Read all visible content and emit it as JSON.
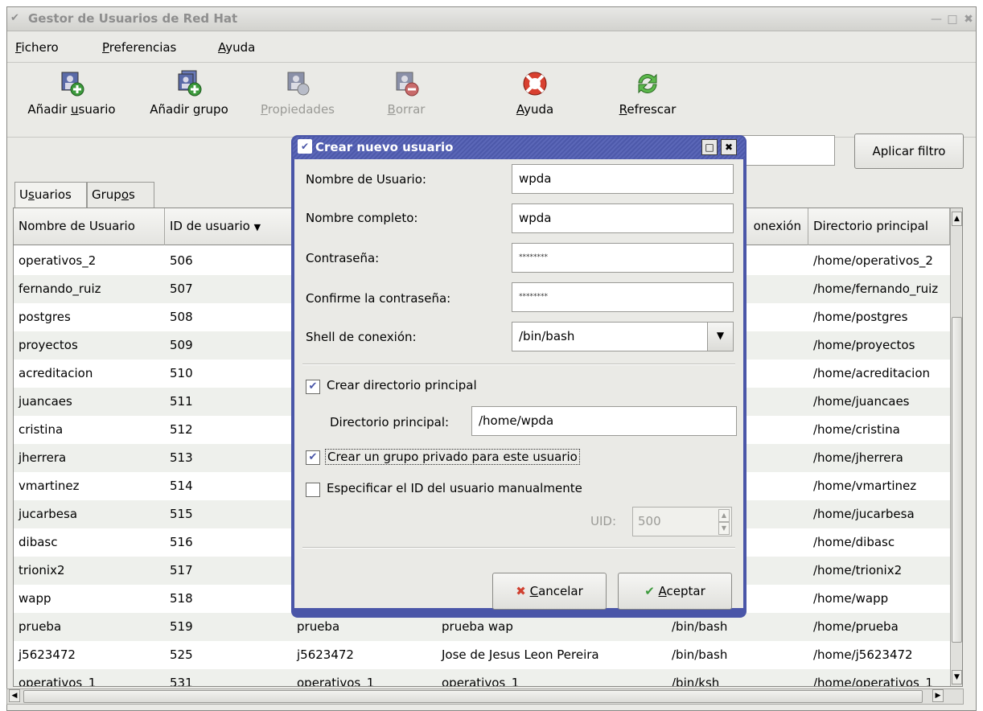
{
  "window": {
    "title": "Gestor de Usuarios de Red Hat"
  },
  "menubar": {
    "items": [
      {
        "pre": "",
        "u": "F",
        "post": "ichero"
      },
      {
        "pre": "",
        "u": "P",
        "post": "referencias"
      },
      {
        "pre": "",
        "u": "A",
        "post": "yuda"
      }
    ]
  },
  "toolbar": {
    "items": [
      {
        "pre": "Añadir ",
        "u": "u",
        "post": "suario",
        "icon": "add-user-icon",
        "disabled": false
      },
      {
        "pre": "Añadir ",
        "u": "g",
        "post": "rupo",
        "icon": "add-group-icon",
        "disabled": false
      },
      {
        "pre": "",
        "u": "P",
        "post": "ropiedades",
        "icon": "properties-icon",
        "disabled": true
      },
      {
        "pre": "",
        "u": "B",
        "post": "orrar",
        "icon": "delete-icon",
        "disabled": true
      },
      {
        "pre": "",
        "u": "A",
        "post": "yuda",
        "icon": "help-icon",
        "disabled": false
      },
      {
        "pre": "",
        "u": "R",
        "post": "efrescar",
        "icon": "refresh-icon",
        "disabled": false
      }
    ]
  },
  "filter": {
    "button_label": "Aplicar filtro",
    "value": ""
  },
  "tabs": [
    {
      "pre": "U",
      "u": "s",
      "post": "uarios",
      "active": true
    },
    {
      "pre": "Grup",
      "u": "o",
      "post": "s",
      "active": false
    }
  ],
  "table": {
    "columns": [
      "Nombre de Usuario",
      "ID de usuario",
      "",
      "",
      "onexión",
      "Directorio principal"
    ],
    "rows": [
      [
        "operativos_2",
        "506",
        "",
        "",
        "",
        "/home/operativos_2"
      ],
      [
        "fernando_ruiz",
        "507",
        "",
        "",
        "",
        "/home/fernando_ruiz"
      ],
      [
        "postgres",
        "508",
        "",
        "",
        "",
        "/home/postgres"
      ],
      [
        "proyectos",
        "509",
        "",
        "",
        "",
        "/home/proyectos"
      ],
      [
        "acreditacion",
        "510",
        "",
        "",
        "",
        "/home/acreditacion"
      ],
      [
        "juancaes",
        "511",
        "",
        "",
        "",
        "/home/juancaes"
      ],
      [
        "cristina",
        "512",
        "",
        "",
        "",
        "/home/cristina"
      ],
      [
        "jherrera",
        "513",
        "",
        "",
        "",
        "/home/jherrera"
      ],
      [
        "vmartinez",
        "514",
        "",
        "",
        "",
        "/home/vmartinez"
      ],
      [
        "jucarbesa",
        "515",
        "",
        "",
        "",
        "/home/jucarbesa"
      ],
      [
        "dibasc",
        "516",
        "",
        "",
        "",
        "/home/dibasc"
      ],
      [
        "trionix2",
        "517",
        "",
        "",
        "",
        "/home/trionix2"
      ],
      [
        "wapp",
        "518",
        "",
        "",
        "",
        "/home/wapp"
      ],
      [
        "prueba",
        "519",
        "prueba",
        "prueba wap",
        "/bin/bash",
        "/home/prueba"
      ],
      [
        "j5623472",
        "525",
        "j5623472",
        "Jose de Jesus Leon Pereira",
        "/bin/bash",
        "/home/j5623472"
      ],
      [
        "operativos_1",
        "531",
        "operativos_1",
        "operativos_1",
        "/bin/ksh",
        "/home/operativos_1"
      ]
    ]
  },
  "dialog": {
    "title": "Crear nuevo usuario",
    "username_label": "Nombre de Usuario:",
    "username_value": "wpda",
    "fullname_label": "Nombre completo:",
    "fullname_value": "wpda",
    "password_label": "Contraseña:",
    "password_value": "********",
    "confirm_label": "Confirme la contraseña:",
    "confirm_value": "********",
    "shell_label": "Shell de conexión:",
    "shell_value": "/bin/bash",
    "create_home_label": "Crear directorio principal",
    "create_home_checked": true,
    "home_dir_label": "Directorio principal:",
    "home_dir_value": "/home/wpda",
    "private_group_label": "Crear un grupo privado para este usuario",
    "private_group_checked": true,
    "manual_uid_label": "Especificar el ID del usuario manualmente",
    "manual_uid_checked": false,
    "uid_label": "UID:",
    "uid_value": "500",
    "cancel": {
      "u": "C",
      "post": "ancelar"
    },
    "accept": {
      "u": "A",
      "post": "ceptar"
    }
  }
}
